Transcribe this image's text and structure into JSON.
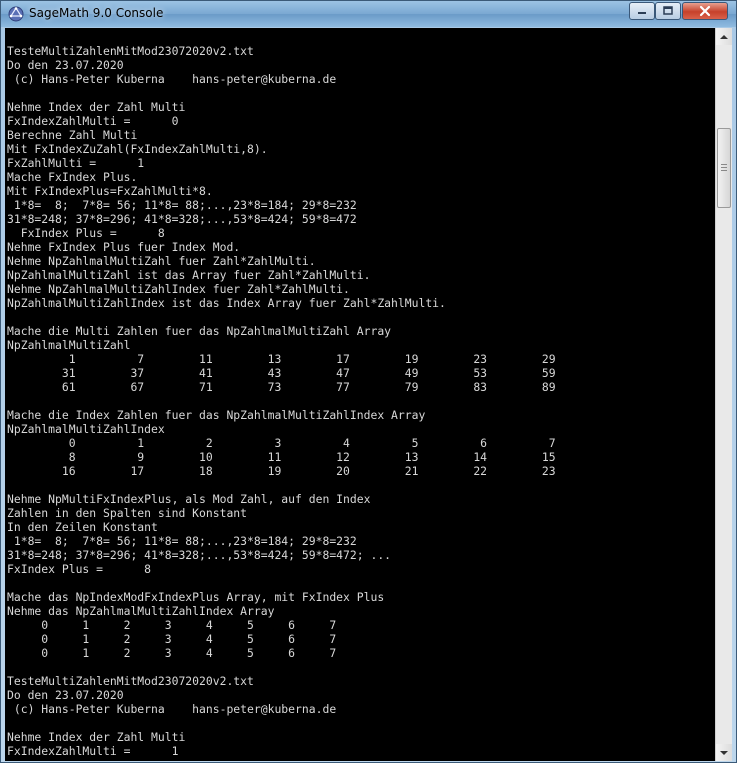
{
  "window": {
    "title": "SageMath 9.0 Console",
    "icon": "sagemath-icon"
  },
  "controls": {
    "minimize_icon": "minimize-icon",
    "maximize_icon": "maximize-icon",
    "close_icon": "close-icon"
  },
  "colors": {
    "console_bg": "#000000",
    "console_text": "#d8d8d8",
    "close_button": "#c6412b"
  },
  "console": {
    "lines": [
      "TesteMultiZahlenMitMod23072020v2.txt",
      "Do den 23.07.2020",
      " (c) Hans-Peter Kuberna    hans-peter@kuberna.de",
      "",
      "Nehme Index der Zahl Multi",
      "FxIndexZahlMulti =      0",
      "Berechne Zahl Multi",
      "Mit FxIndexZuZahl(FxIndexZahlMulti,8).",
      "FxZahlMulti =      1",
      "Mache FxIndex Plus.",
      "Mit FxIndexPlus=FxZahlMulti*8.",
      " 1*8=  8;  7*8= 56; 11*8= 88;...,23*8=184; 29*8=232",
      "31*8=248; 37*8=296; 41*8=328;...,53*8=424; 59*8=472",
      "  FxIndex Plus =      8",
      "Nehme FxIndex Plus fuer Index Mod.",
      "Nehme NpZahlmalMultiZahl fuer Zahl*ZahlMulti.",
      "NpZahlmalMultiZahl ist das Array fuer Zahl*ZahlMulti.",
      "Nehme NpZahlmalMultiZahlIndex fuer Zahl*ZahlMulti.",
      "NpZahlmalMultiZahlIndex ist das Index Array fuer Zahl*ZahlMulti.",
      "",
      "Mache die Multi Zahlen fuer das NpZahlmalMultiZahl Array",
      "NpZahlmalMultiZahl",
      "         1         7        11        13        17        19        23        29",
      "        31        37        41        43        47        49        53        59",
      "        61        67        71        73        77        79        83        89",
      "",
      "Mache die Index Zahlen fuer das NpZahlmalMultiZahlIndex Array",
      "NpZahlmalMultiZahlIndex",
      "         0         1         2         3         4         5         6         7",
      "         8         9        10        11        12        13        14        15",
      "        16        17        18        19        20        21        22        23",
      "",
      "Nehme NpMultiFxIndexPlus, als Mod Zahl, auf den Index",
      "Zahlen in den Spalten sind Konstant",
      "In den Zeilen Konstant",
      " 1*8=  8;  7*8= 56; 11*8= 88;...,23*8=184; 29*8=232",
      "31*8=248; 37*8=296; 41*8=328;...,53*8=424; 59*8=472; ...",
      "FxIndex Plus =      8",
      "",
      "Mache das NpIndexModFxIndexPlus Array, mit FxIndex Plus",
      "Nehme das NpZahlmalMultiZahlIndex Array",
      "     0     1     2     3     4     5     6     7",
      "     0     1     2     3     4     5     6     7",
      "     0     1     2     3     4     5     6     7",
      "",
      "TesteMultiZahlenMitMod23072020v2.txt",
      "Do den 23.07.2020",
      " (c) Hans-Peter Kuberna    hans-peter@kuberna.de",
      "",
      "Nehme Index der Zahl Multi",
      "FxIndexZahlMulti =      1"
    ]
  }
}
